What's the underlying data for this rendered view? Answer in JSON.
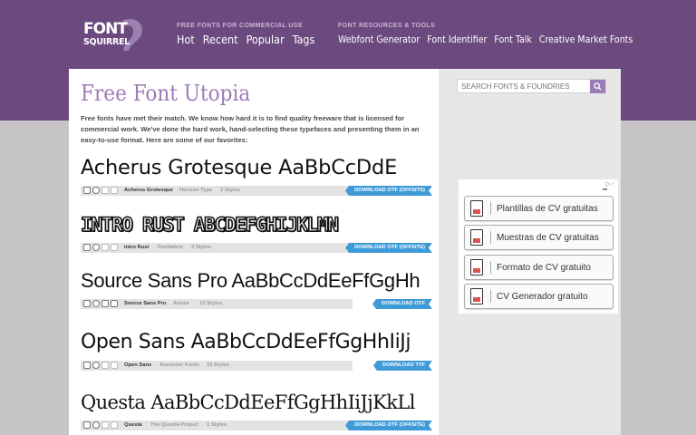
{
  "header": {
    "logo_top": "FONT",
    "logo_bottom": "SQUIRREL",
    "nav_main_label": "FREE FONTS FOR COMMERCIAL USE",
    "nav_main": [
      "Hot",
      "Recent",
      "Popular",
      "Tags"
    ],
    "nav_resources_label": "FONT RESOURCES & TOOLS",
    "nav_resources": [
      "Webfont Generator",
      "Font Identifier",
      "Font Talk",
      "Creative Market Fonts"
    ]
  },
  "main": {
    "title": "Free Font Utopia",
    "intro": "Free fonts have met their match. We know how hard it is to find quality freeware that is licensed for commercial work. We've done the hard work, hand-selecting these typefaces and presenting them in an easy-to-use format. Here are some of our favorites:",
    "fonts": [
      {
        "sample": "Acherus Grotesque AaBbCcDdE",
        "name": "Acherus Grotesque",
        "foundry": "Horizon Type",
        "styles": "2 Styles",
        "download": "DOWNLOAD OTF (OFFSITE)"
      },
      {
        "sample": "INTRO RUST ABCDEFGHIJKLMN",
        "name": "Intro Rust",
        "foundry": "Fontfabric",
        "styles": "3 Styles",
        "download": "DOWNLOAD OTF (OFFSITE)"
      },
      {
        "sample": "Source Sans Pro AaBbCcDdEeFfGgHh",
        "name": "Source Sans Pro",
        "foundry": "Adobe",
        "styles": "12 Styles",
        "download": "DOWNLOAD OTF"
      },
      {
        "sample": "Open Sans AaBbCcDdEeFfGgHhIiJj",
        "name": "Open Sans",
        "foundry": "Ascender Fonts",
        "styles": "10 Styles",
        "download": "DOWNLOAD TTF"
      },
      {
        "sample": "Questa AaBbCcDdEeFfGgHhIiJjKkLl",
        "name": "Questa",
        "foundry": "The Questa Project",
        "styles": "1 Styles",
        "download": "DOWNLOAD OTF (OFFSITE)"
      }
    ]
  },
  "sidebar": {
    "search_placeholder": "SEARCH FONTS & FOUNDRIES",
    "ad_buttons": [
      "Plantillas de CV gratuitas",
      "Muestras de CV gratuitas",
      "Formato de CV gratuito",
      "CV Generador gratuito"
    ]
  },
  "colors": {
    "header_bg": "#6c4a7f",
    "accent_purple": "#9e7ab9",
    "download_blue": "#3f9ad8"
  }
}
